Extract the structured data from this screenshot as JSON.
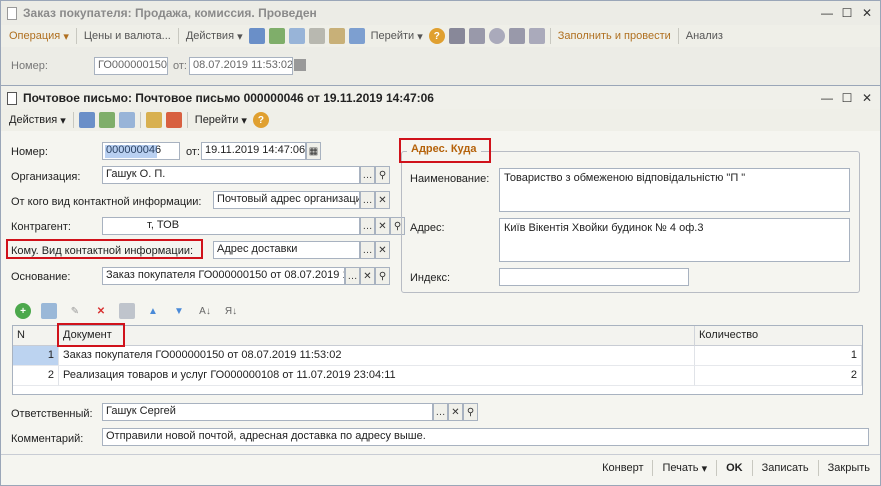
{
  "bg_window": {
    "title": "Заказ покупателя: Продажа, комиссия. Проведен",
    "toolbar": {
      "operation": "Операция",
      "prices": "Цены и валюта...",
      "actions": "Действия",
      "goto": "Перейти",
      "fill_and_post": "Заполнить и провести",
      "analysis": "Анализ"
    },
    "number_label": "Номер:",
    "number_value": "ГО000000150",
    "from_label": "от:",
    "date_value": "08.07.2019 11:53:02"
  },
  "fg_window": {
    "title": "Почтовое письмо: Почтовое письмо 000000046 от 19.11.2019 14:47:06",
    "toolbar": {
      "actions": "Действия",
      "goto": "Перейти"
    },
    "form": {
      "number_label": "Номер:",
      "number_value": "000000046",
      "from_label": "от:",
      "date_value": "19.11.2019 14:47:06",
      "org_label": "Организация:",
      "org_value": "Гашук О. П.",
      "from_whom_label": "От кого вид контактной информации:",
      "from_whom_value": "Почтовый адрес организаци",
      "contractor_label": "Контрагент:",
      "contractor_value": "т, ТОВ",
      "to_whom_label": "Кому. Вид контактной информации:",
      "to_whom_value": "Адрес доставки",
      "basis_label": "Основание:",
      "basis_value": "Заказ покупателя ГО000000150 от 08.07.2019 1"
    },
    "address": {
      "group_title": "Адрес. Куда",
      "name_label": "Наименование:",
      "name_value": "Товариство з обмеженою відповідальністю \"П          \"",
      "address_label": "Адрес:",
      "address_value": "Київ Вікентія Хвойки будинок №        4 оф.3",
      "index_label": "Индекс:",
      "index_value": ""
    },
    "table": {
      "columns": [
        "N",
        "Документ",
        "Количество"
      ],
      "rows": [
        {
          "n": "1",
          "doc": "Заказ покупателя ГО000000150 от 08.07.2019 11:53:02",
          "qty": "1"
        },
        {
          "n": "2",
          "doc": "Реализация товаров и услуг ГО000000108 от 11.07.2019 23:04:11",
          "qty": "2"
        }
      ]
    },
    "responsible_label": "Ответственный:",
    "responsible_value": "Гашук Сергей",
    "comment_label": "Комментарий:",
    "comment_value": "Отправили новой почтой, адресная доставка по адресу выше.",
    "bottom": {
      "convert": "Конверт",
      "print": "Печать",
      "ok": "OK",
      "save": "Записать",
      "close": "Закрыть"
    }
  },
  "colors": {
    "highlight_red": "#d0121b",
    "selected_row": "#dce8f7",
    "group_title": "#b5620a"
  }
}
